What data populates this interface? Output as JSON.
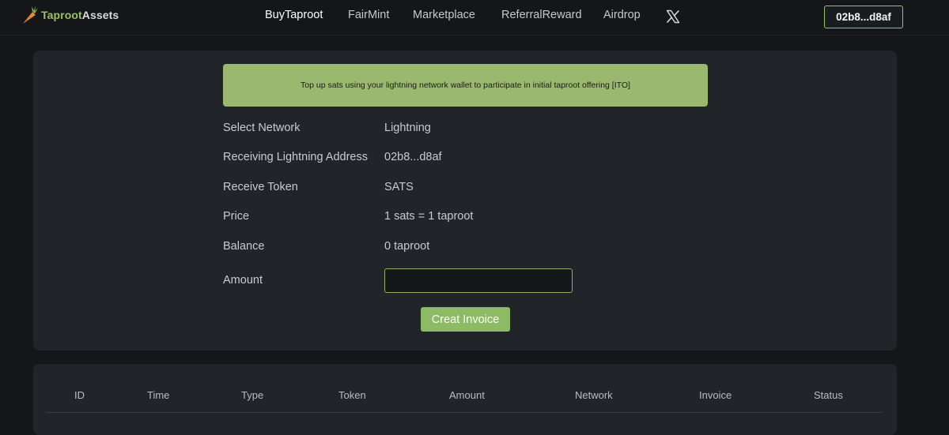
{
  "header": {
    "logo": {
      "part1": "Taproot",
      "part2": "Assets"
    },
    "nav": [
      {
        "label": "BuyTaproot",
        "active": true
      },
      {
        "label": "FairMint",
        "active": false
      },
      {
        "label": "Marketplace",
        "active": false
      },
      {
        "label": "ReferralReward",
        "active": false
      },
      {
        "label": "Airdrop",
        "active": false
      }
    ],
    "x_icon": "x-twitter-icon",
    "wallet_address": "02b8...d8af"
  },
  "main": {
    "banner": "Top up sats using your lightning network wallet to participate in initial taproot offering [ITO]",
    "fields": [
      {
        "label": "Select Network",
        "value": "Lightning"
      },
      {
        "label": "Receiving Lightning Address",
        "value": "02b8...d8af"
      },
      {
        "label": "Receive Token",
        "value": "SATS"
      },
      {
        "label": "Price",
        "value": "1 sats = 1 taproot"
      },
      {
        "label": "Balance",
        "value": "0 taproot"
      }
    ],
    "amount": {
      "label": "Amount",
      "value": "",
      "placeholder": ""
    },
    "create_button": "Creat Invoice"
  },
  "table": {
    "columns": [
      "ID",
      "Time",
      "Type",
      "Token",
      "Amount",
      "Network",
      "Invoice",
      "Status"
    ]
  },
  "colors": {
    "accent": "#9ac25e",
    "banner": "#9ab86e",
    "button": "#8dba64",
    "background": "#141619",
    "card": "#212429"
  }
}
